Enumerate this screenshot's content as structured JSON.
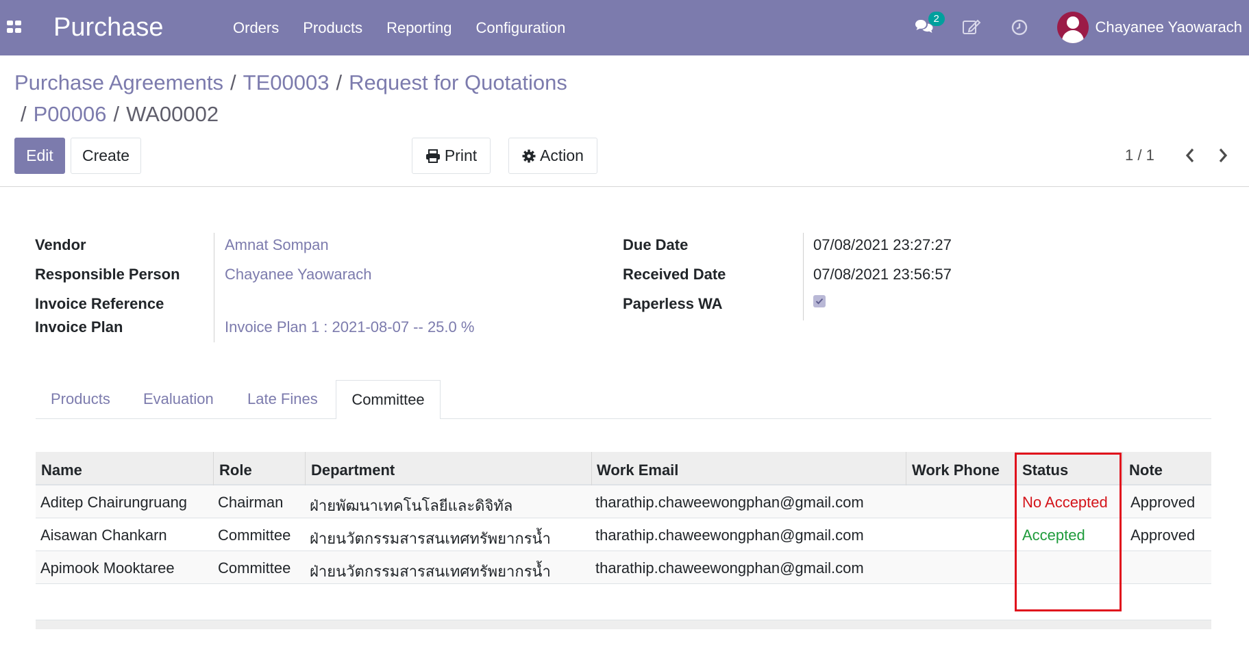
{
  "navbar": {
    "app_title": "Purchase",
    "menu": [
      "Orders",
      "Products",
      "Reporting",
      "Configuration"
    ],
    "chat_count": "2",
    "user_name": "Chayanee Yaowarach",
    "icons": [
      "apps-grid-icon",
      "chat-icon",
      "edit-note-icon",
      "clock-icon"
    ],
    "bg_color": "#7c7bad"
  },
  "breadcrumb": {
    "items": [
      "Purchase Agreements",
      "TE00003",
      "Request for Quotations",
      "P00006"
    ],
    "current": "WA00002",
    "separator": "/"
  },
  "buttons": {
    "edit": "Edit",
    "create": "Create",
    "print": "Print",
    "action": "Action"
  },
  "pager": {
    "value": "1 / 1"
  },
  "record": {
    "title": "WA00002"
  },
  "fields": {
    "vendor": {
      "label": "Vendor",
      "value": "Amnat Sompan"
    },
    "responsible": {
      "label": "Responsible Person",
      "value": "Chayanee Yaowarach"
    },
    "invoice_reference": {
      "label": "Invoice Reference",
      "value": ""
    },
    "invoice_plan": {
      "label": "Invoice Plan",
      "value": "Invoice Plan 1 : 2021-08-07 -- 25.0 %"
    },
    "due_date": {
      "label": "Due Date",
      "value": "07/08/2021 23:27:27"
    },
    "received_date": {
      "label": "Received Date",
      "value": "07/08/2021 23:56:57"
    },
    "paperless_wa": {
      "label": "Paperless WA",
      "checked": true
    }
  },
  "tabs": [
    "Products",
    "Evaluation",
    "Late Fines",
    "Committee"
  ],
  "active_tab": "Committee",
  "committee_table": {
    "columns": [
      "Name",
      "Role",
      "Department",
      "Work Email",
      "Work Phone",
      "Status",
      "Note"
    ],
    "rows": [
      [
        "Aditep Chairungruang",
        "Chairman",
        "ฝ่ายพัฒนาเทคโนโลยีและดิจิทัล",
        "tharathip.chaweewongphan@gmail.com",
        "",
        "No Accepted",
        "Approved"
      ],
      [
        "Aisawan Chankarn",
        "Committee",
        "ฝ่ายนวัตกรรมสารสนเทศทรัพยากรน้ำ",
        "tharathip.chaweewongphan@gmail.com",
        "",
        "Accepted",
        "Approved"
      ],
      [
        "Apimook Mooktaree",
        "Committee",
        "ฝ่ายนวัตกรรมสารสนเทศทรัพยากรน้ำ",
        "tharathip.chaweewongphan@gmail.com",
        "",
        "",
        ""
      ]
    ],
    "status_colors": {
      "No Accepted": "#d4141a",
      "Accepted": "#1e9b3b"
    },
    "highlight_color": "#e0101c"
  }
}
